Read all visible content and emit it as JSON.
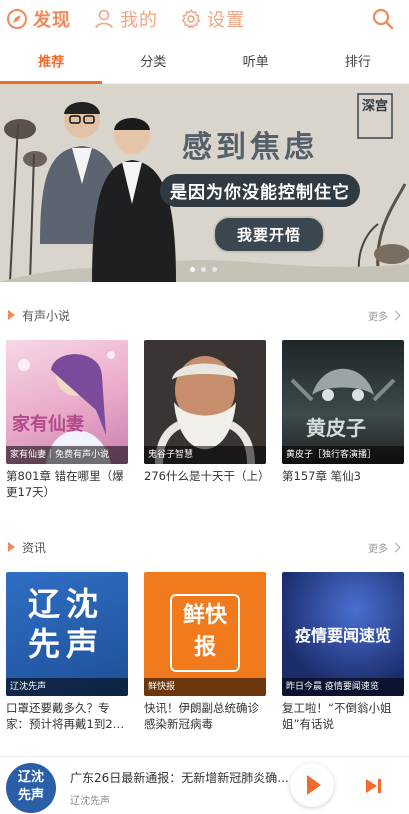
{
  "topnav": {
    "items": [
      {
        "label": "发现",
        "icon": "compass-icon"
      },
      {
        "label": "我的",
        "icon": "person-icon"
      },
      {
        "label": "设置",
        "icon": "gear-icon"
      }
    ],
    "search_icon": "search-icon",
    "accent": "#f08a5a"
  },
  "tabs": [
    {
      "label": "推荐",
      "active": true
    },
    {
      "label": "分类"
    },
    {
      "label": "听单"
    },
    {
      "label": "排行"
    }
  ],
  "banner": {
    "title1": "感到焦虑",
    "title2": "是因为你没能控制住它",
    "cta": "我要开悟",
    "logo": "深宫",
    "slide": 1,
    "slides": 3
  },
  "sections": [
    {
      "title": "有声小说",
      "more": "更多",
      "items": [
        {
          "tag": "家有仙妻｜免费有声小说",
          "caption": "第801章 错在哪里（爆更17天）",
          "cover_text": "家有仙妻"
        },
        {
          "tag": "鬼谷子智慧",
          "caption": "276什么是十天干（上）",
          "cover_text": ""
        },
        {
          "tag": "黄皮子［独行客演播］",
          "caption": "第157章 笔仙3",
          "cover_text": "黄皮子"
        }
      ]
    },
    {
      "title": "资讯",
      "more": "更多",
      "items": [
        {
          "tag": "辽沈先声",
          "caption": "口罩还要戴多久？专家：预计将再戴1到2…",
          "cover_text": "辽沈先声"
        },
        {
          "tag": "鲜快报",
          "caption": "快讯！伊朗副总统确诊感染新冠病毒",
          "cover_text": "鲜快报"
        },
        {
          "tag": "昨日今晨 疫情要闻速览",
          "caption": "复工啦！“不倒翁小姐姐”有话说",
          "cover_text": "疫情要闻速览"
        }
      ]
    }
  ],
  "player": {
    "title": "广东26日最新通报：无新增新冠肺炎确...",
    "subtitle": "辽沈先声",
    "thumb_text": "辽沈先声"
  }
}
